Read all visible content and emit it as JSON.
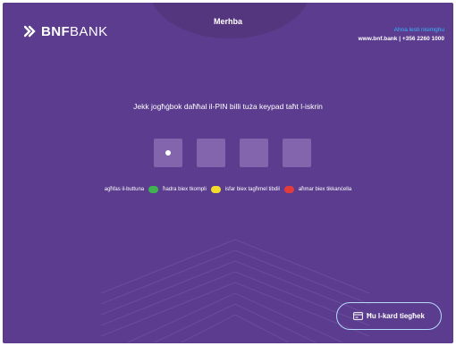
{
  "header": {
    "logo_bold": "BNF",
    "logo_light": "BANK",
    "greeting": "Merhba",
    "help_question": "Ahna lesti nisimghu",
    "help_contact": "www.bnf.bank | +356 2260 1000"
  },
  "main": {
    "instruction": "Jekk jogħġbok daħħal il-PIN billi tuża keypad taħt l-iskrin",
    "pin_length": 4,
    "pin_entered": 1
  },
  "legend": {
    "intro": "agħfas il-buttuna",
    "items": [
      {
        "label": "ħadra biex tkompli",
        "color": "#3fb34f"
      },
      {
        "label": "isfar biex tagħmel tibdil",
        "color": "#f4dc2b"
      },
      {
        "label": "aħmar biex tikkanċella",
        "color": "#e23b3b"
      }
    ]
  },
  "footer": {
    "card_button_label": "Ħu l-kard tiegħek"
  },
  "colors": {
    "background": "#5b3c8e",
    "pin_box": "#8265ad",
    "accent_blue": "#35b8ff",
    "button_border": "#b7d8ff"
  }
}
